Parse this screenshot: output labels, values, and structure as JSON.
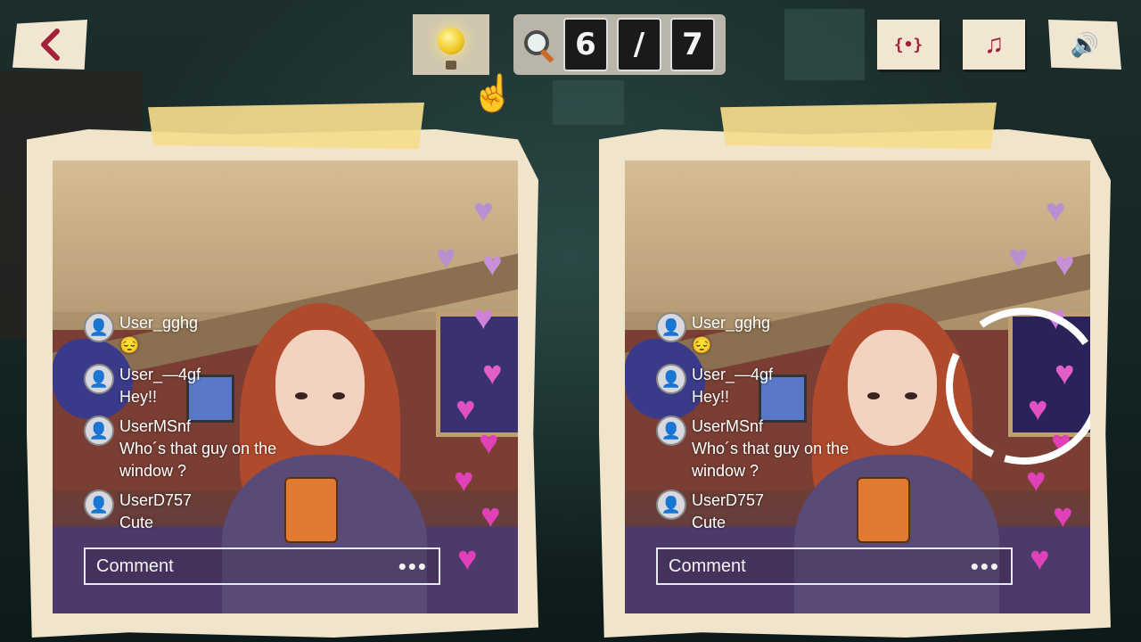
{
  "header": {
    "found": "6",
    "separator": "/",
    "total": "7"
  },
  "toolbar": {
    "back_icon": "chevron-left-icon",
    "fx_label": "{•}",
    "music_icon": "♫",
    "sound_icon": "🔊"
  },
  "chat": {
    "messages": [
      {
        "user": "User_gghg",
        "text": "😔"
      },
      {
        "user": "User_—4gf",
        "text": "Hey!!"
      },
      {
        "user": "UserMSnf",
        "text": "Who´s that guy on the window ?"
      },
      {
        "user": "UserD757",
        "text": "Cute"
      }
    ],
    "comment_placeholder": "Comment",
    "more": "•••"
  },
  "colors": {
    "accent": "#a3213a",
    "paper": "#f0e4cb",
    "tape": "#f5dc8c",
    "heart_pink": "#e040b8",
    "heart_lilac": "#b890d0"
  }
}
